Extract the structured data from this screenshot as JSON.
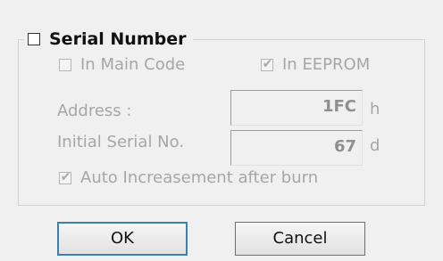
{
  "serial_number": {
    "label": "Serial Number",
    "enabled": false,
    "in_main_code": {
      "label": "In Main Code",
      "checked": false
    },
    "in_eeprom": {
      "label": "In EEPROM",
      "checked": true
    },
    "address": {
      "label": "Address :",
      "value": "1FC",
      "unit": "h"
    },
    "initial_serial": {
      "label": "Initial Serial No.",
      "value": "67",
      "unit": "d"
    },
    "auto_increase": {
      "label": "Auto Increasement after burn",
      "checked": true
    }
  },
  "buttons": {
    "ok_label": "OK",
    "cancel_label": "Cancel"
  },
  "icons": {
    "checkmark": "checkmark-icon"
  }
}
